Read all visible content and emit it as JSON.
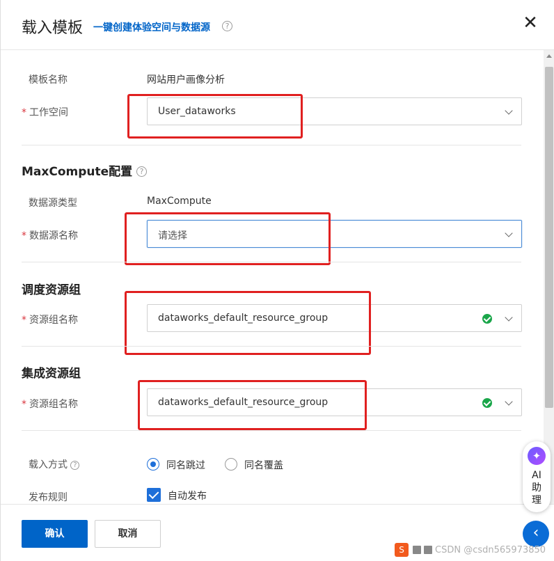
{
  "header": {
    "title": "载入模板",
    "subtitle": "一键创建体验空间与数据源",
    "help_glyph": "?",
    "close_glyph": "✕"
  },
  "form": {
    "template_name": {
      "label": "模板名称",
      "value": "网站用户画像分析"
    },
    "workspace": {
      "required_mark": "*",
      "label": "工作空间",
      "value": "User_dataworks"
    },
    "maxcompute": {
      "title": "MaxCompute配置",
      "datasource_type": {
        "label": "数据源类型",
        "value": "MaxCompute"
      },
      "datasource_name": {
        "required_mark": "*",
        "label": "数据源名称",
        "placeholder": "请选择"
      }
    },
    "scheduling_group": {
      "title": "调度资源组",
      "resource_group": {
        "required_mark": "*",
        "label": "资源组名称",
        "value": "dataworks_default_resource_group"
      }
    },
    "integration_group": {
      "title": "集成资源组",
      "resource_group": {
        "required_mark": "*",
        "label": "资源组名称",
        "value": "dataworks_default_resource_group"
      }
    },
    "load_mode": {
      "label": "载入方式",
      "options": [
        {
          "label": "同名跳过",
          "checked": true
        },
        {
          "label": "同名覆盖",
          "checked": false
        }
      ]
    },
    "publish_rule": {
      "label": "发布规则",
      "option": "自动发布",
      "checked": true
    }
  },
  "footer": {
    "confirm_label": "确认",
    "cancel_label": "取消"
  },
  "ai_assistant": {
    "logo_glyph": "✦",
    "line1": "AI",
    "line2": "助",
    "line3": "理"
  },
  "collapse_glyph": "‹",
  "watermark": {
    "logo_glyph": "S",
    "text": "CSDN @csdn565973850"
  },
  "colors": {
    "primary": "#0064c8",
    "annotation_red": "#e02020",
    "success": "#1aa64a",
    "required": "#d9363e"
  }
}
